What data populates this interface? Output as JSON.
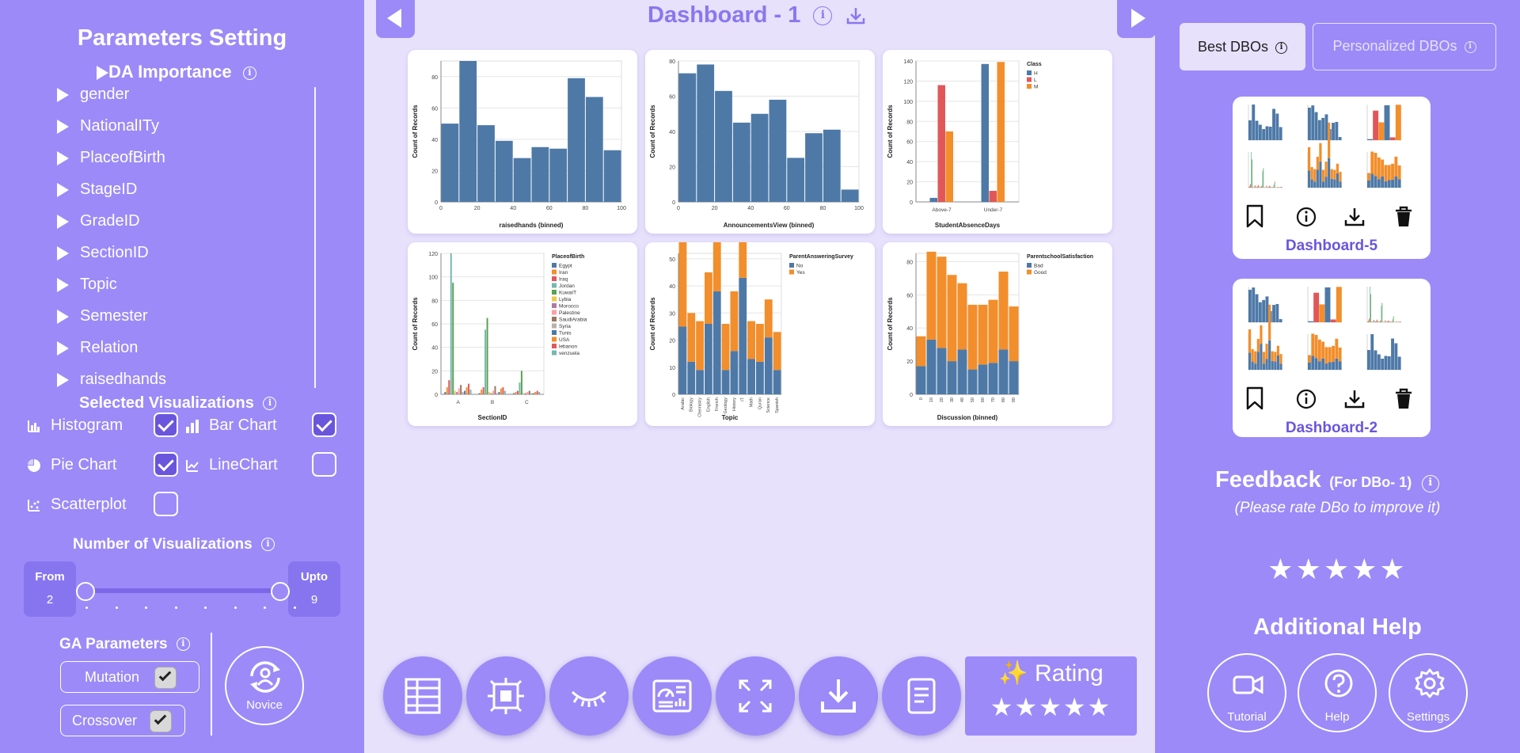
{
  "left": {
    "title": "Parameters Setting",
    "da_importance": "DA Importance",
    "attributes": [
      "gender",
      "NationalITy",
      "PlaceofBirth",
      "StageID",
      "GradeID",
      "SectionID",
      "Topic",
      "Semester",
      "Relation",
      "raisedhands"
    ],
    "selected_vis_title": "Selected Visualizations",
    "visualizations": [
      {
        "label": "Histogram",
        "checked": true,
        "icon": "histogram-icon"
      },
      {
        "label": "Bar Chart",
        "checked": true,
        "icon": "bar-chart-icon"
      },
      {
        "label": "Pie Chart",
        "checked": true,
        "icon": "pie-chart-icon"
      },
      {
        "label": "LineChart",
        "checked": false,
        "icon": "line-chart-icon"
      },
      {
        "label": "Scatterplot",
        "checked": false,
        "icon": "scatterplot-icon"
      }
    ],
    "num_vis_title": "Number of Visualizations",
    "from_label": "From",
    "from_value": "2",
    "upto_label": "Upto",
    "upto_value": "9",
    "slider_min": 2,
    "slider_max": 9,
    "ga_title": "GA Parameters",
    "mutation": "Mutation",
    "crossover": "Crossover",
    "novice": "Novice"
  },
  "center": {
    "title": "Dashboard - 1",
    "rating_label": "✨ Rating",
    "rating_stars": 5,
    "toolbar_icons": [
      "table-icon",
      "layout-icon",
      "eye-closed-icon",
      "dashboard-icon",
      "expand-icon",
      "download-icon",
      "notes-icon"
    ]
  },
  "charts": [
    {
      "type": "histogram",
      "xlabel": "raisedhands (binned)",
      "ylabel": "Count of Records",
      "values": [
        50,
        90,
        49,
        39,
        28,
        35,
        34,
        79,
        67,
        33
      ],
      "yticks": [
        "0",
        "20",
        "40",
        "60",
        "80"
      ],
      "xticks": [
        "0",
        "20",
        "40",
        "60",
        "80",
        "100"
      ],
      "ymax": 90,
      "colors": [
        "#4e79a7"
      ]
    },
    {
      "type": "histogram",
      "xlabel": "AnnouncementsView (binned)",
      "ylabel": "Count of Records",
      "values": [
        73,
        78,
        63,
        45,
        50,
        58,
        25,
        39,
        41,
        7
      ],
      "yticks": [
        "0",
        "20",
        "40",
        "60",
        "80"
      ],
      "xticks": [
        "0",
        "20",
        "40",
        "60",
        "80",
        "100"
      ],
      "ymax": 80,
      "colors": [
        "#4e79a7"
      ]
    },
    {
      "type": "grouped",
      "xlabel": "StudentAbsenceDays",
      "ylabel": "Count of Records",
      "categories": [
        "Above-7",
        "Under-7"
      ],
      "legend_title": "Class",
      "legend": [
        "H",
        "L",
        "M"
      ],
      "colors": [
        "#4e79a7",
        "#e15759",
        "#f28e2b"
      ],
      "values": [
        [
          4,
          116,
          70
        ],
        [
          137,
          11,
          139
        ]
      ],
      "ymax": 140,
      "yticks": [
        "0",
        "20",
        "40",
        "60",
        "80",
        "100",
        "120",
        "140"
      ]
    },
    {
      "type": "grouped",
      "xlabel": "SectionID",
      "ylabel": "Count of Records",
      "categories": [
        "A",
        "B",
        "C"
      ],
      "legend_title": "PlaceofBirth",
      "legend": [
        "Egypt",
        "Iran",
        "Iraq",
        "Jordan",
        "KuwaIT",
        "Lybia",
        "Morocco",
        "Palestine",
        "SaudiArabia",
        "Syria",
        "Tunis",
        "USA",
        "lebanon",
        "venzuela"
      ],
      "colors": [
        "#4e79a7",
        "#f28e2b",
        "#e15759",
        "#76b7b2",
        "#59a14f",
        "#edc948",
        "#b07aa1",
        "#ff9da7",
        "#9c755f",
        "#bab0ac",
        "#4e79a7",
        "#f28e2b",
        "#e15759",
        "#76b7b2"
      ],
      "values": [
        [
          2,
          6,
          12,
          120,
          95,
          3,
          2,
          5,
          8,
          2,
          3,
          6,
          9,
          4
        ],
        [
          1,
          4,
          6,
          55,
          65,
          2,
          1,
          3,
          7,
          1,
          2,
          5,
          6,
          3
        ],
        [
          1,
          2,
          3,
          10,
          20,
          1,
          1,
          2,
          3,
          1,
          1,
          2,
          3,
          2
        ]
      ],
      "ymax": 120,
      "yticks": [
        "0",
        "20",
        "40",
        "60",
        "80",
        "100",
        "120"
      ]
    },
    {
      "type": "stacked",
      "xlabel": "Topic",
      "ylabel": "Count of Records",
      "categories": [
        "Arabic",
        "Biology",
        "Chemistry",
        "English",
        "French",
        "Geology",
        "History",
        "IT",
        "Math",
        "Quran",
        "Science",
        "Spanish"
      ],
      "legend_title": "ParentAnsweringSurvey",
      "legend": [
        "No",
        "Yes"
      ],
      "colors": [
        "#4e79a7",
        "#f28e2b"
      ],
      "values": [
        [
          25,
          34
        ],
        [
          12,
          18
        ],
        [
          9,
          18
        ],
        [
          26,
          19
        ],
        [
          38,
          27
        ],
        [
          9,
          17
        ],
        [
          16,
          22
        ],
        [
          43,
          52
        ],
        [
          13,
          14
        ],
        [
          12,
          14
        ],
        [
          21,
          14
        ],
        [
          9,
          14
        ]
      ],
      "ymax": 52,
      "yticks": [
        "0",
        "10",
        "20",
        "30",
        "40",
        "50"
      ]
    },
    {
      "type": "stacked",
      "xlabel": "Discussion (binned)",
      "ylabel": "Count of Records",
      "categories": [
        "0",
        "10",
        "20",
        "30",
        "40",
        "50",
        "60",
        "70",
        "80",
        "90"
      ],
      "legend_title": "ParentschoolSatisfaction",
      "legend": [
        "Bad",
        "Good"
      ],
      "colors": [
        "#4e79a7",
        "#f28e2b"
      ],
      "values": [
        [
          17,
          18
        ],
        [
          33,
          53
        ],
        [
          28,
          55
        ],
        [
          20,
          52
        ],
        [
          27,
          40
        ],
        [
          15,
          39
        ],
        [
          18,
          36
        ],
        [
          19,
          38
        ],
        [
          27,
          47
        ],
        [
          20,
          33
        ]
      ],
      "ymax": 85,
      "yticks": [
        "0",
        "20",
        "40",
        "60",
        "80"
      ]
    }
  ],
  "right": {
    "tabs": {
      "best": "Best DBOs",
      "personalized": "Personalized DBOs"
    },
    "dashboards": [
      {
        "name": "Dashboard-5"
      },
      {
        "name": "Dashboard-2"
      }
    ],
    "feedback_title": "Feedback",
    "feedback_sub": "(For DBo- 1)",
    "feedback_hint": "(Please rate DBo to improve it)",
    "feedback_stars": 5,
    "help_title": "Additional Help",
    "help_buttons": [
      "Tutorial",
      "Help",
      "Settings"
    ]
  }
}
